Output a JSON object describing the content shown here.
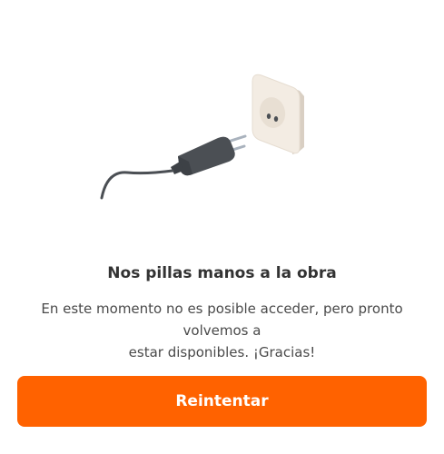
{
  "illustration": {
    "icon": "unplugged-charger-icon",
    "colors": {
      "socket_face": "#f3ece3",
      "socket_side": "#d9cfc3",
      "plug_body": "#4b4f54",
      "cable": "#4b4f54",
      "prongs": "#a9b2bd"
    }
  },
  "error": {
    "title": "Nos pillas manos a la obra",
    "message_line1": "En este momento no es posible acceder, pero pronto volvemos a",
    "message_line2": "estar disponibles. ¡Gracias!"
  },
  "actions": {
    "retry_label": "Reintentar"
  },
  "colors": {
    "accent": "#ff6200",
    "title_text": "#333333",
    "body_text": "#4a4a4a"
  }
}
